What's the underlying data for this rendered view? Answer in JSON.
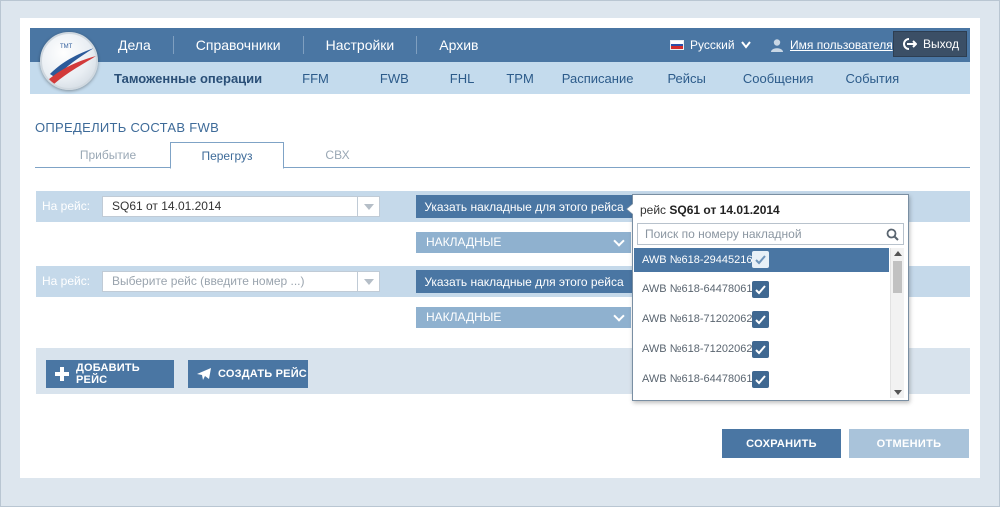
{
  "header": {
    "nav": [
      "Дела",
      "Справочники",
      "Настройки",
      "Архив"
    ],
    "language": "Русский",
    "user_name": "Имя пользователя",
    "logout": "Выход",
    "subnav": [
      "Таможенные операции",
      "FFM",
      "FWB",
      "FHL",
      "TPM",
      "Расписание",
      "Рейсы",
      "Сообщения",
      "События"
    ],
    "active_subnav": "Таможенные операции"
  },
  "page": {
    "title": "ОПРЕДЕЛИТЬ СОСТАВ FWB",
    "tabs": [
      "Прибытие",
      "Перегруз",
      "СВХ"
    ],
    "active_tab": "Перегруз"
  },
  "flights": [
    {
      "label": "На рейс:",
      "value": "SQ61 от 14.01.2014",
      "awb_button": "Указать накладные для этого рейса",
      "waybills": "НАКЛАДНЫЕ"
    },
    {
      "label": "На рейс:",
      "placeholder": "Выберите рейс (введите номер ...)",
      "awb_button": "Указать накладные для этого рейса",
      "waybills": "НАКЛАДНЫЕ"
    }
  ],
  "actions": {
    "add_flight": "ДОБАВИТЬ РЕЙС",
    "create_flight": "СОЗДАТЬ РЕЙС",
    "save": "СОХРАНИТЬ",
    "cancel": "ОТМЕНИТЬ"
  },
  "popup": {
    "title_prefix": "рейс",
    "title_flight": "SQ61 от 14.01.2014",
    "search_placeholder": "Поиск по номеру накладной",
    "items": [
      {
        "awb": "AWB №618-29445216",
        "checked": true,
        "selected": true
      },
      {
        "awb": "AWB №618-64478061",
        "checked": true,
        "selected": false
      },
      {
        "awb": "AWB №618-71202062",
        "checked": true,
        "selected": false
      },
      {
        "awb": "AWB №618-71202062",
        "checked": true,
        "selected": false
      },
      {
        "awb": "AWB №618-64478061",
        "checked": true,
        "selected": false
      }
    ]
  },
  "colors": {
    "primary": "#4a76a3",
    "header_sub": "#c4dbed",
    "row": "#c5d9ea",
    "logout_bg": "#3b4f66"
  },
  "icons": [
    "logo-icon",
    "chevron-down-icon",
    "user-icon",
    "logout-icon",
    "plus-icon",
    "airplane-icon",
    "search-icon",
    "check-icon"
  ]
}
